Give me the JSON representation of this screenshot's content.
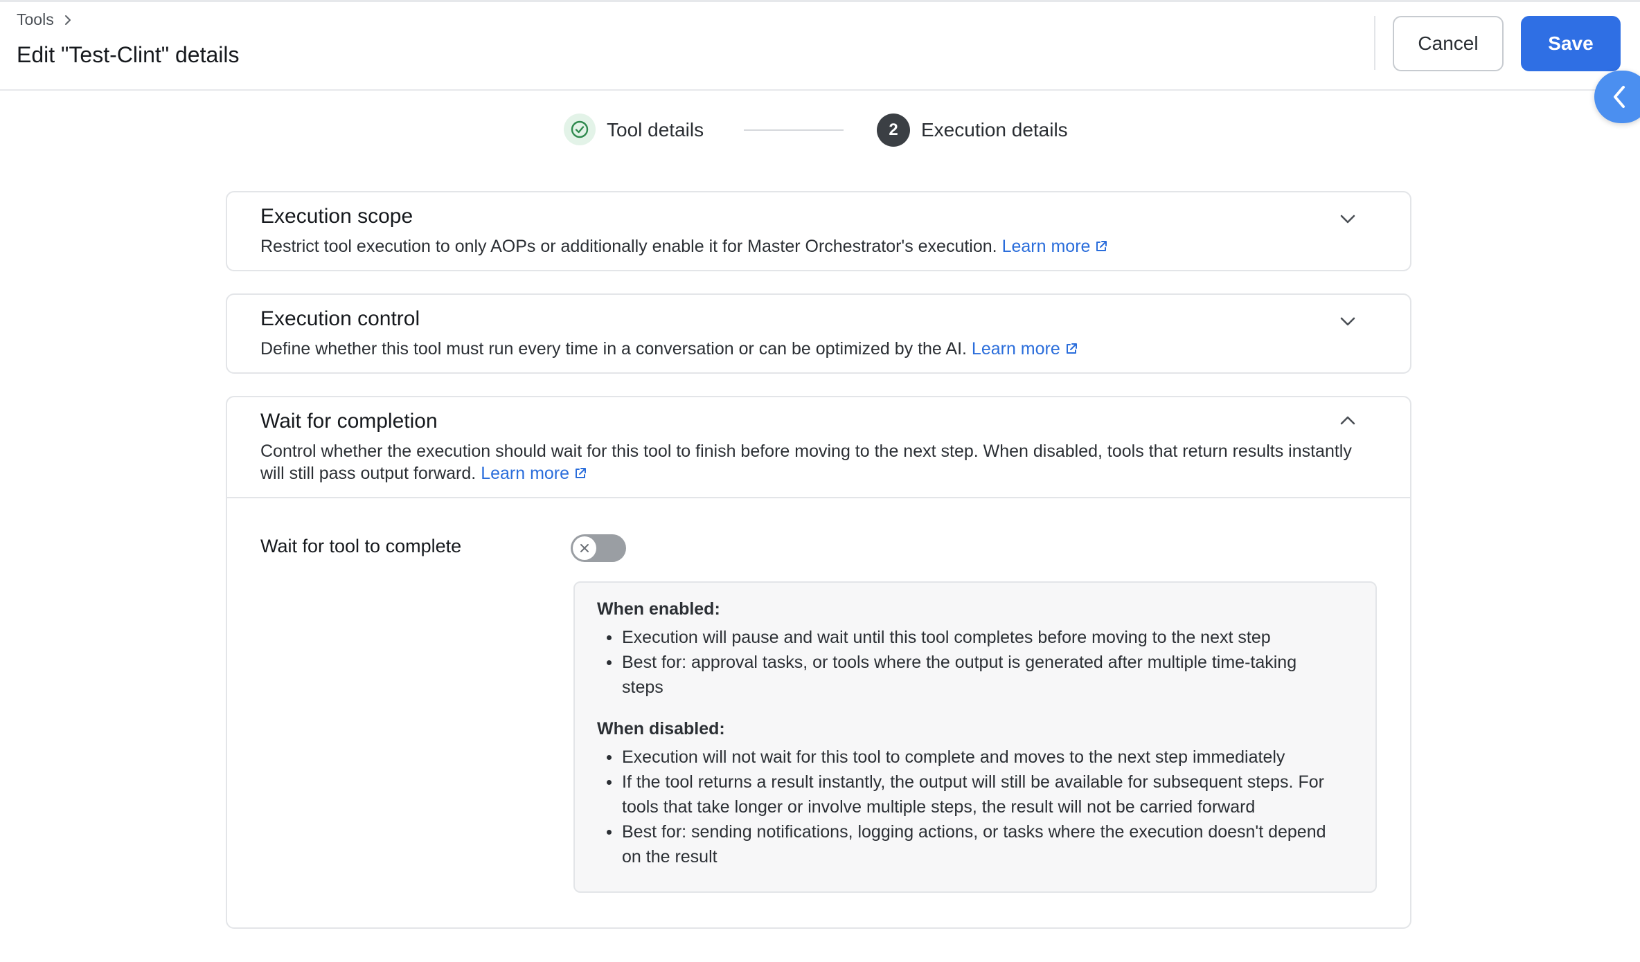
{
  "breadcrumb": {
    "parent": "Tools"
  },
  "header": {
    "title": "Edit \"Test-Clint\" details",
    "cancel_label": "Cancel",
    "save_label": "Save"
  },
  "stepper": {
    "steps": [
      {
        "label": "Tool details",
        "status": "completed"
      },
      {
        "label": "Execution details",
        "status": "active",
        "number": "2"
      }
    ]
  },
  "sections": [
    {
      "title": "Execution scope",
      "description": "Restrict tool execution to only AOPs or additionally enable it for Master Orchestrator's execution.",
      "link": "Learn more",
      "expanded": false
    },
    {
      "title": "Execution control",
      "description": "Define whether this tool must run every time in a conversation or can be optimized by the AI.",
      "link": "Learn more",
      "expanded": false
    },
    {
      "title": "Wait for completion",
      "description": "Control whether the execution should wait for this tool to finish before moving to the next step. When disabled, tools that return results instantly will still pass output forward.",
      "link": "Learn more",
      "expanded": true,
      "field_label": "Wait for tool to complete",
      "toggle_on": false,
      "info": {
        "enabled_heading": "When enabled:",
        "enabled_items": [
          "Execution will pause and wait until this tool completes before moving to the next step",
          "Best for: approval tasks, or tools where the output is generated after multiple time-taking steps"
        ],
        "disabled_heading": "When disabled:",
        "disabled_items": [
          "Execution will not wait for this tool to complete and moves to the next step immediately",
          "If the tool returns a result instantly, the output will still be available for subsequent steps. For tools that take longer or involve multiple steps, the result will not be carried forward",
          "Best for: sending notifications, logging actions, or tasks where the execution doesn't depend on the result"
        ]
      }
    }
  ],
  "colors": {
    "accent": "#2f6fe4",
    "link": "#2a6ddb",
    "success": "#2f8a4e",
    "side_toggle": "#4b8ff0"
  },
  "icons": {
    "breadcrumb": "chevron-right-icon",
    "side_toggle": "chevron-left-icon",
    "step_done": "check-circle-icon",
    "collapsed": "chevron-down-icon",
    "expanded": "chevron-up-icon",
    "link": "external-link-icon",
    "toggle_off": "x-icon"
  }
}
